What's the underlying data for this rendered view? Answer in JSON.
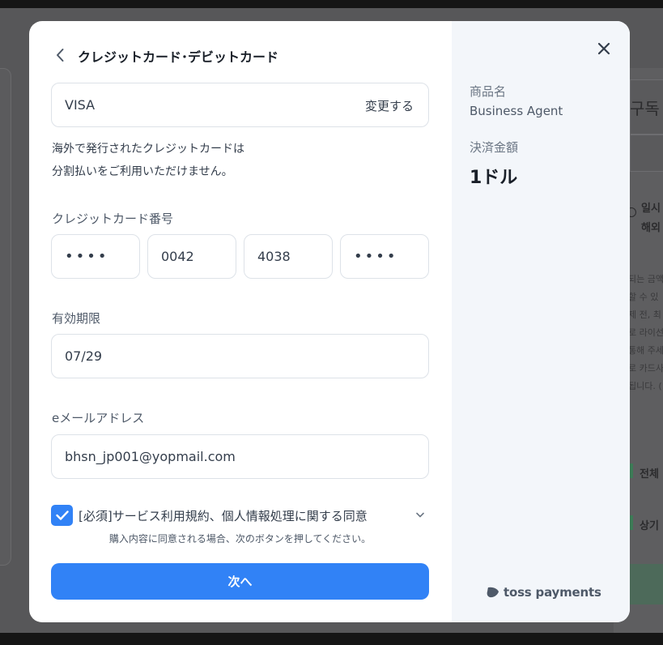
{
  "background": {
    "labels": [
      "구독",
      "일시",
      "해외",
      "전체",
      "상기"
    ],
    "lines": [
      "되는 금액",
      "할 수 있",
      "제 전, 최",
      "로 라이선",
      "통해 주세",
      "로 카드사",
      "됩니다. ("
    ]
  },
  "modal": {
    "title": "クレジットカード･デビットカード",
    "card_type": {
      "value": "VISA",
      "change_label": "変更する"
    },
    "notice_lines": [
      "海外で発行されたクレジットカードは",
      "分割払いをご利用いただけません。"
    ],
    "card_number": {
      "label": "クレジットカード番号",
      "segments": [
        "••••",
        "0042",
        "4038",
        "••••"
      ]
    },
    "expiry": {
      "label": "有効期限",
      "value": "07/29"
    },
    "email": {
      "label": "eメールアドレス",
      "value": "bhsn_jp001@yopmail.com"
    },
    "agreement": {
      "checked": true,
      "text": "[必須]サービス利用規約、個人情報処理に関する同意",
      "subtext": "購入内容に同意される場合、次のボタンを押してください。"
    },
    "next_label": "次へ"
  },
  "summary": {
    "product_label": "商品名",
    "product_value": "Business Agent",
    "amount_label": "決済金額",
    "amount_value": "1ドル",
    "brand": "toss payments"
  },
  "colors": {
    "accent": "#3182f6",
    "panel": "#f3f6fa",
    "border": "#dde2e8"
  },
  "icons": [
    "chevron-left-icon",
    "close-icon",
    "check-icon",
    "chevron-down-icon",
    "toss-logo-icon"
  ]
}
